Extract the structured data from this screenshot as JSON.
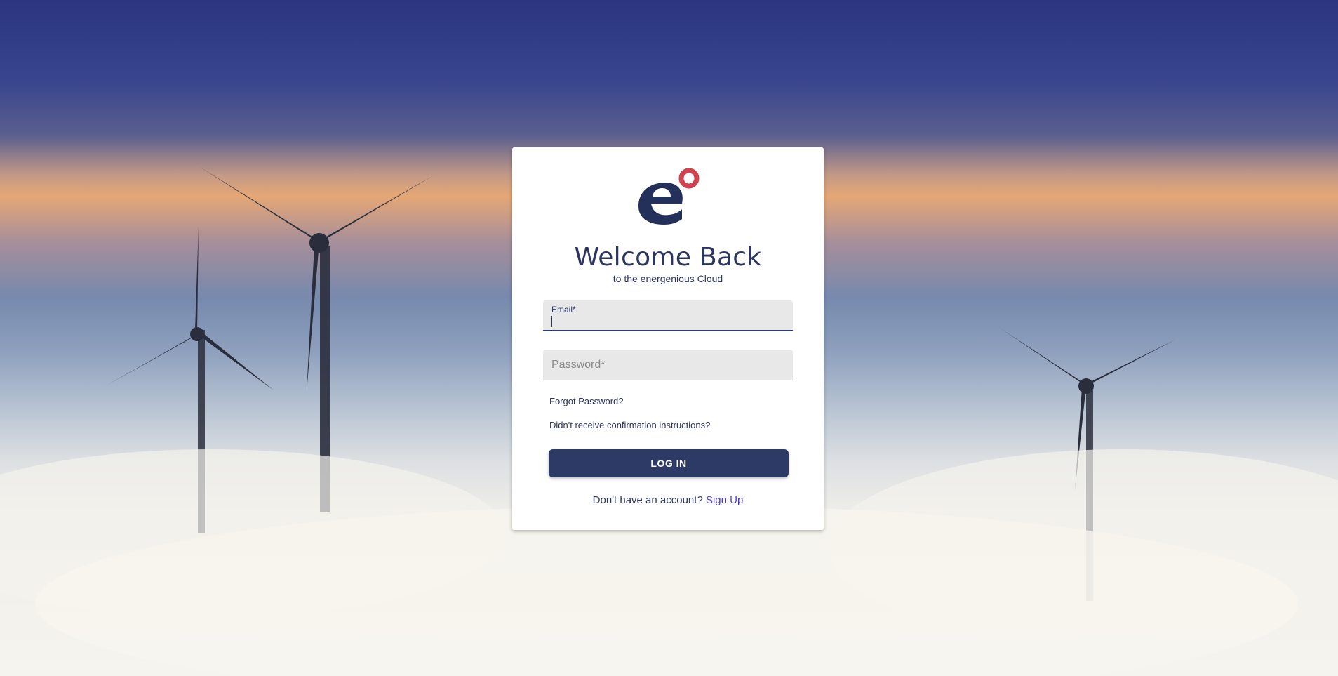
{
  "login_card": {
    "logo_icon": "energenious-e-logo",
    "title": "Welcome Back",
    "subtitle": "to the energenious Cloud",
    "email_field": {
      "label": "Email*",
      "value": ""
    },
    "password_field": {
      "label": "Password*",
      "value": ""
    },
    "forgot_password_link": "Forgot Password?",
    "confirmation_link": "Didn't receive confirmation instructions?",
    "login_button": "LOG IN",
    "signup_prompt": "Don't have an account?",
    "signup_link": "Sign Up"
  },
  "colors": {
    "primary": "#2e3a66",
    "logo_accent": "#d0424d",
    "link_accent": "#4b3bd1"
  },
  "background": {
    "description_icon": "wind-turbines-above-clouds-image"
  }
}
